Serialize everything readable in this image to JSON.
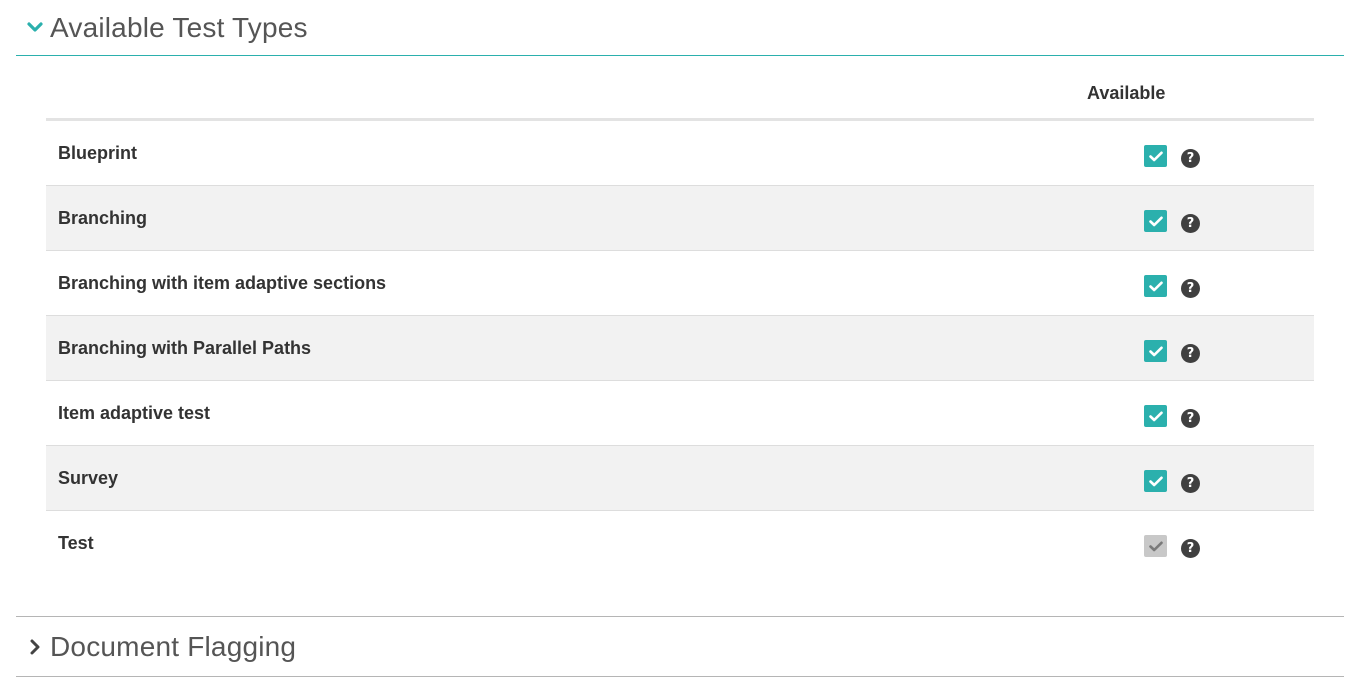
{
  "available_section": {
    "title": "Available Test Types",
    "expanded": true,
    "chevron_icon": "chevron-down-icon",
    "accent_color": "#2bb0ad",
    "column_header": "Available",
    "rows": [
      {
        "label": "Blueprint",
        "checked": true,
        "disabled": false,
        "help": "?"
      },
      {
        "label": "Branching",
        "checked": true,
        "disabled": false,
        "help": "?"
      },
      {
        "label": "Branching with item adaptive sections",
        "checked": true,
        "disabled": false,
        "help": "?"
      },
      {
        "label": "Branching with Parallel Paths",
        "checked": true,
        "disabled": false,
        "help": "?"
      },
      {
        "label": "Item adaptive test",
        "checked": true,
        "disabled": false,
        "help": "?"
      },
      {
        "label": "Survey",
        "checked": true,
        "disabled": false,
        "help": "?"
      },
      {
        "label": "Test",
        "checked": true,
        "disabled": true,
        "help": "?"
      }
    ]
  },
  "flagging_section": {
    "title": "Document Flagging",
    "expanded": false,
    "chevron_icon": "chevron-right-icon"
  }
}
